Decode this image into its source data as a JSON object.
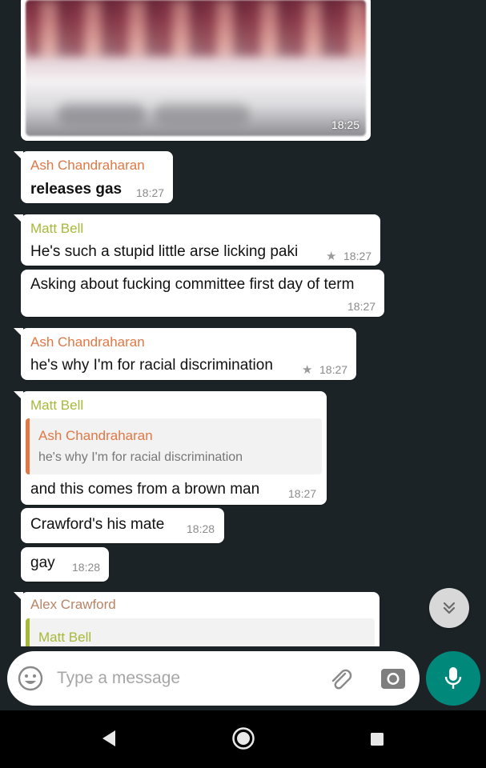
{
  "colors": {
    "ash": "#e07845",
    "matt": "#a8b93a",
    "alex": "#b98466",
    "accent": "#00897b"
  },
  "image_message": {
    "time": "18:25"
  },
  "messages": [
    {
      "sender": "Ash Chandraharan",
      "text": "releases gas",
      "time": "18:27"
    },
    {
      "sender": "Matt Bell",
      "text": "He's such a stupid little arse licking paki",
      "time": "18:27",
      "starred": true
    },
    {
      "text": "Asking about fucking committee first day of term",
      "time": "18:27"
    },
    {
      "sender": "Ash Chandraharan",
      "text": "he's why I'm for racial discrimination",
      "time": "18:27",
      "starred": true
    },
    {
      "sender": "Matt Bell",
      "quote": {
        "sender": "Ash Chandraharan",
        "text": "he's why I'm for racial discrimination"
      },
      "text": "and this comes from a brown man",
      "time": "18:27"
    },
    {
      "text": "Crawford's his mate",
      "time": "18:28"
    },
    {
      "text": "gay",
      "time": "18:28"
    },
    {
      "sender": "Alex Crawford",
      "quote": {
        "sender": "Matt Bell"
      }
    }
  ],
  "input": {
    "placeholder": "Type a message"
  },
  "icons": {
    "emoji": "emoji-icon",
    "attach": "paperclip-icon",
    "camera": "camera-icon",
    "mic": "microphone-icon",
    "scroll": "chevron-double-down-icon",
    "nav_back": "back-triangle-icon",
    "nav_home": "home-circle-icon",
    "nav_recent": "recent-square-icon"
  }
}
